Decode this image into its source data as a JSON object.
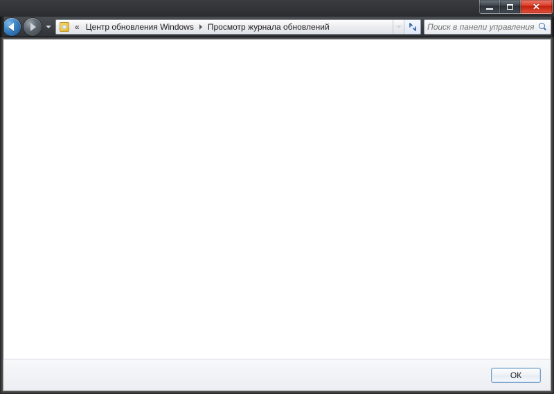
{
  "titlebar": {
    "minimize_label": "Minimize",
    "maximize_label": "Maximize",
    "close_label": "Close"
  },
  "nav": {
    "overflow_glyph": "«",
    "breadcrumb": [
      "Центр обновления Windows",
      "Просмотр журнала обновлений"
    ]
  },
  "search": {
    "placeholder": "Поиск в панели управления"
  },
  "footer": {
    "ok_label": "ОК"
  }
}
